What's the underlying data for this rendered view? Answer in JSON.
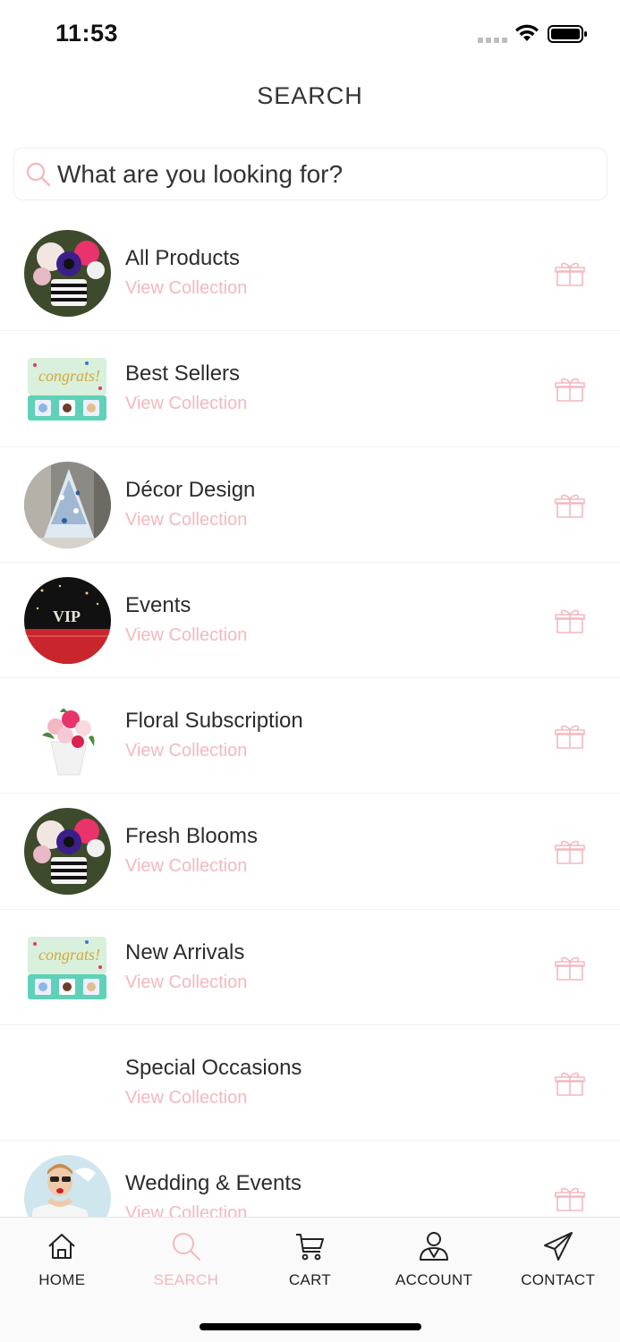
{
  "status_bar": {
    "time": "11:53"
  },
  "header": {
    "title": "SEARCH"
  },
  "search": {
    "placeholder": "What are you looking for?",
    "value": "",
    "icon": "search-icon"
  },
  "collections": [
    {
      "title": "All Products",
      "link": "View Collection",
      "image": "flower-box-photo"
    },
    {
      "title": "Best Sellers",
      "link": "View Collection",
      "image": "congrats-gift-box-photo"
    },
    {
      "title": "Décor Design",
      "link": "View Collection",
      "image": "christmas-tree-photo"
    },
    {
      "title": "Events",
      "link": "View Collection",
      "image": "vip-red-carpet-photo"
    },
    {
      "title": "Floral Subscription",
      "link": "View Collection",
      "image": "bouquet-photo"
    },
    {
      "title": "Fresh Blooms",
      "link": "View Collection",
      "image": "flower-box-photo"
    },
    {
      "title": "New Arrivals",
      "link": "View Collection",
      "image": "congrats-gift-box-photo"
    },
    {
      "title": "Special Occasions",
      "link": "View Collection",
      "image": ""
    },
    {
      "title": "Wedding & Events",
      "link": "View Collection",
      "image": "bride-photo"
    }
  ],
  "tabs": [
    {
      "label": "HOME",
      "icon": "home-icon",
      "active": false
    },
    {
      "label": "SEARCH",
      "icon": "search-icon",
      "active": true
    },
    {
      "label": "CART",
      "icon": "cart-icon",
      "active": false
    },
    {
      "label": "ACCOUNT",
      "icon": "account-icon",
      "active": false
    },
    {
      "label": "CONTACT",
      "icon": "paper-plane-icon",
      "active": false
    }
  ],
  "colors": {
    "accent": "#f3b8bf",
    "text": "#2c2c2c",
    "divider": "#f1f1f1"
  }
}
